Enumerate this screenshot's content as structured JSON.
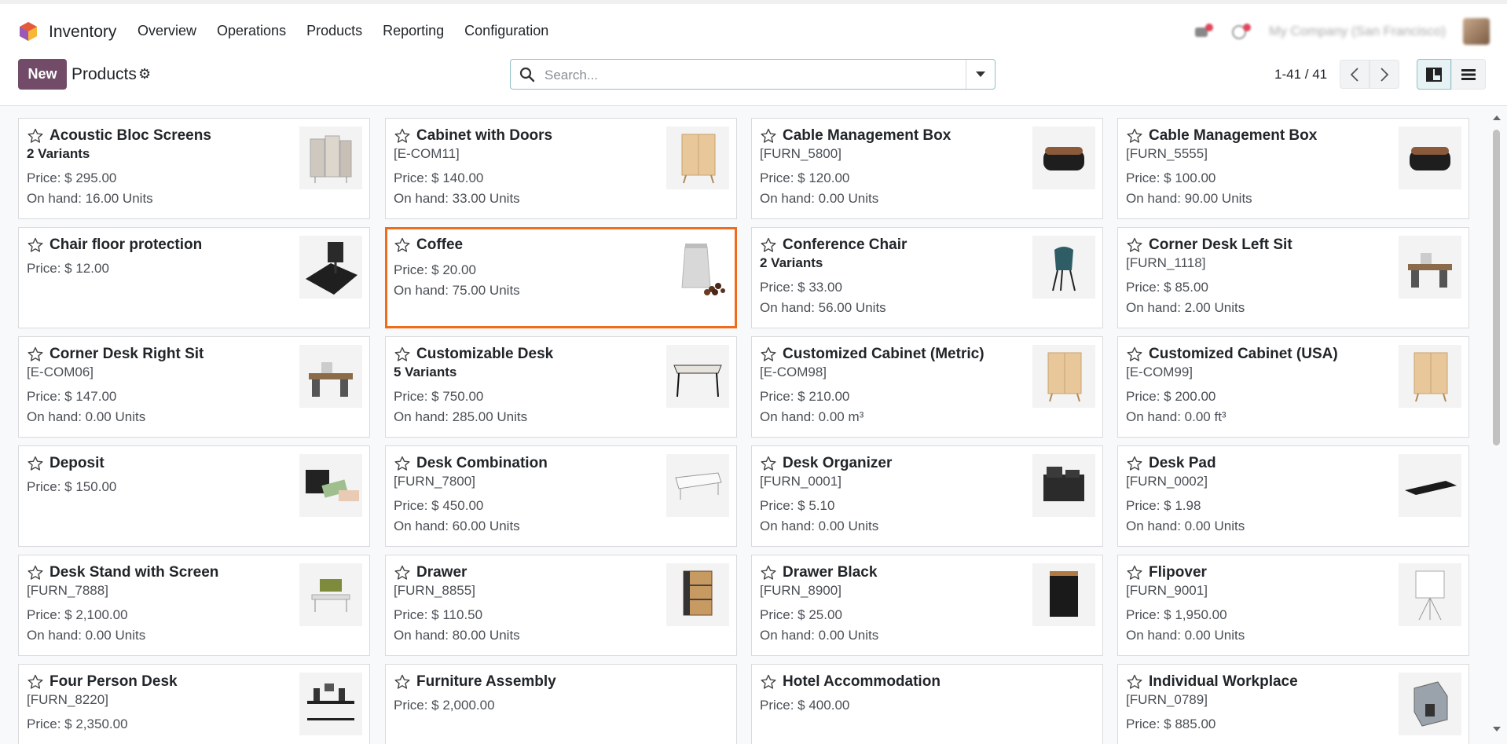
{
  "navbar": {
    "app_name": "Inventory",
    "menu": [
      "Overview",
      "Operations",
      "Products",
      "Reporting",
      "Configuration"
    ],
    "company": "My Company (San Francisco)"
  },
  "control": {
    "new_label": "New",
    "title": "Products",
    "search_placeholder": "Search...",
    "pager": "1-41 / 41"
  },
  "colors": {
    "brand": "#714b67",
    "highlight": "#f06b1b",
    "accent": "#8fc1c8"
  },
  "products": [
    {
      "name": "Acoustic Bloc Screens",
      "sub": "2 Variants",
      "sub_bold": true,
      "price": "Price: $ 295.00",
      "onhand": "On hand: 16.00 Units",
      "icon": "acoustic-screen"
    },
    {
      "name": "Cabinet with Doors",
      "sub": "[E-COM11]",
      "sub_bold": false,
      "price": "Price: $ 140.00",
      "onhand": "On hand: 33.00 Units",
      "icon": "cabinet"
    },
    {
      "name": "Cable Management Box",
      "sub": "[FURN_5800]",
      "sub_bold": false,
      "price": "Price: $ 120.00",
      "onhand": "On hand: 0.00 Units",
      "icon": "cable-box"
    },
    {
      "name": "Cable Management Box",
      "sub": "[FURN_5555]",
      "sub_bold": false,
      "price": "Price: $ 100.00",
      "onhand": "On hand: 90.00 Units",
      "icon": "cable-box"
    },
    {
      "name": "Chair floor protection",
      "sub": "",
      "sub_bold": false,
      "price": "Price: $ 12.00",
      "onhand": "",
      "icon": "floor-mat"
    },
    {
      "name": "Coffee",
      "sub": "",
      "sub_bold": false,
      "price": "Price: $ 20.00",
      "onhand": "On hand: 75.00 Units",
      "icon": "coffee-bag"
    },
    {
      "name": "Conference Chair",
      "sub": "2 Variants",
      "sub_bold": true,
      "price": "Price: $ 33.00",
      "onhand": "On hand: 56.00 Units",
      "icon": "chair"
    },
    {
      "name": "Corner Desk Left Sit",
      "sub": "[FURN_1118]",
      "sub_bold": false,
      "price": "Price: $ 85.00",
      "onhand": "On hand: 2.00 Units",
      "icon": "corner-desk"
    },
    {
      "name": "Corner Desk Right Sit",
      "sub": "[E-COM06]",
      "sub_bold": false,
      "price": "Price: $ 147.00",
      "onhand": "On hand: 0.00 Units",
      "icon": "corner-desk"
    },
    {
      "name": "Customizable Desk",
      "sub": "5 Variants",
      "sub_bold": true,
      "price": "Price: $ 750.00",
      "onhand": "On hand: 285.00 Units",
      "icon": "desk"
    },
    {
      "name": "Customized Cabinet (Metric)",
      "sub": "[E-COM98]",
      "sub_bold": false,
      "price": "Price: $ 210.00",
      "onhand": "On hand: 0.00 m³",
      "icon": "cabinet"
    },
    {
      "name": "Customized Cabinet (USA)",
      "sub": "[E-COM99]",
      "sub_bold": false,
      "price": "Price: $ 200.00",
      "onhand": "On hand: 0.00 ft³",
      "icon": "cabinet"
    },
    {
      "name": "Deposit",
      "sub": "",
      "sub_bold": false,
      "price": "Price: $ 150.00",
      "onhand": "",
      "icon": "money"
    },
    {
      "name": "Desk Combination",
      "sub": "[FURN_7800]",
      "sub_bold": false,
      "price": "Price: $ 450.00",
      "onhand": "On hand: 60.00 Units",
      "icon": "desk-combo"
    },
    {
      "name": "Desk Organizer",
      "sub": "[FURN_0001]",
      "sub_bold": false,
      "price": "Price: $ 5.10",
      "onhand": "On hand: 0.00 Units",
      "icon": "organizer"
    },
    {
      "name": "Desk Pad",
      "sub": "[FURN_0002]",
      "sub_bold": false,
      "price": "Price: $ 1.98",
      "onhand": "On hand: 0.00 Units",
      "icon": "desk-pad"
    },
    {
      "name": "Desk Stand with Screen",
      "sub": "[FURN_7888]",
      "sub_bold": false,
      "price": "Price: $ 2,100.00",
      "onhand": "On hand: 0.00 Units",
      "icon": "desk-stand"
    },
    {
      "name": "Drawer",
      "sub": "[FURN_8855]",
      "sub_bold": false,
      "price": "Price: $ 110.50",
      "onhand": "On hand: 80.00 Units",
      "icon": "drawer"
    },
    {
      "name": "Drawer Black",
      "sub": "[FURN_8900]",
      "sub_bold": false,
      "price": "Price: $ 25.00",
      "onhand": "On hand: 0.00 Units",
      "icon": "drawer-black"
    },
    {
      "name": "Flipover",
      "sub": "[FURN_9001]",
      "sub_bold": false,
      "price": "Price: $ 1,950.00",
      "onhand": "On hand: 0.00 Units",
      "icon": "flipover"
    },
    {
      "name": "Four Person Desk",
      "sub": "[FURN_8220]",
      "sub_bold": false,
      "price": "Price: $ 2,350.00",
      "onhand": "",
      "icon": "four-desk"
    },
    {
      "name": "Furniture Assembly",
      "sub": "",
      "sub_bold": false,
      "price": "Price: $ 2,000.00",
      "onhand": "",
      "icon": ""
    },
    {
      "name": "Hotel Accommodation",
      "sub": "",
      "sub_bold": false,
      "price": "Price: $ 400.00",
      "onhand": "",
      "icon": ""
    },
    {
      "name": "Individual Workplace",
      "sub": "[FURN_0789]",
      "sub_bold": false,
      "price": "Price: $ 885.00",
      "onhand": "",
      "icon": "workplace"
    }
  ]
}
